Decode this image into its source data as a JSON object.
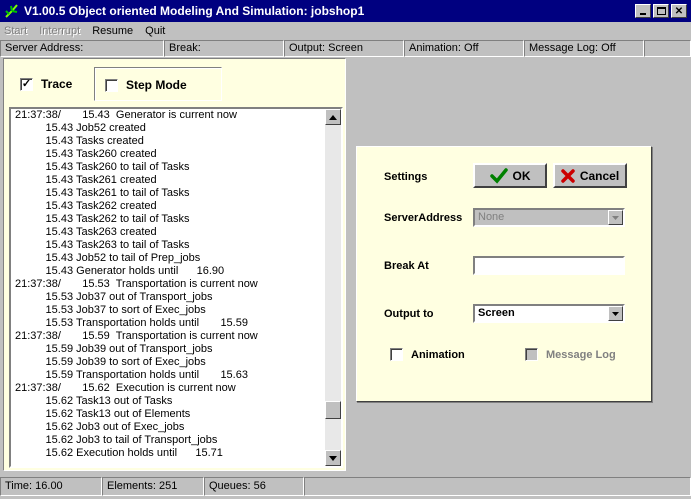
{
  "window": {
    "title": "V1.00.5 Object oriented Modeling And Simulation: jobshop1",
    "icon": "app-leaf-icon"
  },
  "menu": [
    {
      "label": "Start",
      "disabled": true
    },
    {
      "label": "Interrupt",
      "disabled": true
    },
    {
      "label": "Resume",
      "disabled": false
    },
    {
      "label": "Quit",
      "disabled": false
    }
  ],
  "infobar": {
    "server": "Server Address:",
    "break": "Break:",
    "output": "Output: Screen",
    "animation": "Animation: Off",
    "message_log": "Message Log: Off"
  },
  "left": {
    "trace_label": "Trace",
    "trace_checked": true,
    "step_label": "Step Mode",
    "step_checked": false
  },
  "log": [
    "21:37:38/       15.43  Generator is current now",
    "          15.43 Job52 created",
    "          15.43 Tasks created",
    "          15.43 Task260 created",
    "          15.43 Task260 to tail of Tasks",
    "          15.43 Task261 created",
    "          15.43 Task261 to tail of Tasks",
    "          15.43 Task262 created",
    "          15.43 Task262 to tail of Tasks",
    "          15.43 Task263 created",
    "          15.43 Task263 to tail of Tasks",
    "          15.43 Job52 to tail of Prep_jobs",
    "          15.43 Generator holds until      16.90",
    "21:37:38/       15.53  Transportation is current now",
    "          15.53 Job37 out of Transport_jobs",
    "          15.53 Job37 to sort of Exec_jobs",
    "          15.53 Transportation holds until       15.59",
    "21:37:38/       15.59  Transportation is current now",
    "          15.59 Job39 out of Transport_jobs",
    "          15.59 Job39 to sort of Exec_jobs",
    "          15.59 Transportation holds until       15.63",
    "21:37:38/       15.62  Execution is current now",
    "          15.62 Task13 out of Tasks",
    "          15.62 Task13 out of Elements",
    "          15.62 Job3 out of Exec_jobs",
    "          15.62 Job3 to tail of Transport_jobs",
    "          15.62 Execution holds until      15.71"
  ],
  "settings": {
    "heading": "Settings",
    "ok_label": "OK",
    "cancel_label": "Cancel",
    "server_label": "ServerAddress",
    "server_value": "None",
    "break_label": "Break At",
    "break_value": "",
    "output_label": "Output to",
    "output_value": "Screen",
    "animation_label": "Animation",
    "message_log_label": "Message Log"
  },
  "status": {
    "time": "Time: 16.00",
    "elements": "Elements: 251",
    "queues": "Queues: 56"
  },
  "colors": {
    "titlebar": "#000080",
    "panel": "#ffffe1",
    "face": "#c0c0c0",
    "ok_check": "#008000",
    "cancel_x": "#cc0000"
  }
}
